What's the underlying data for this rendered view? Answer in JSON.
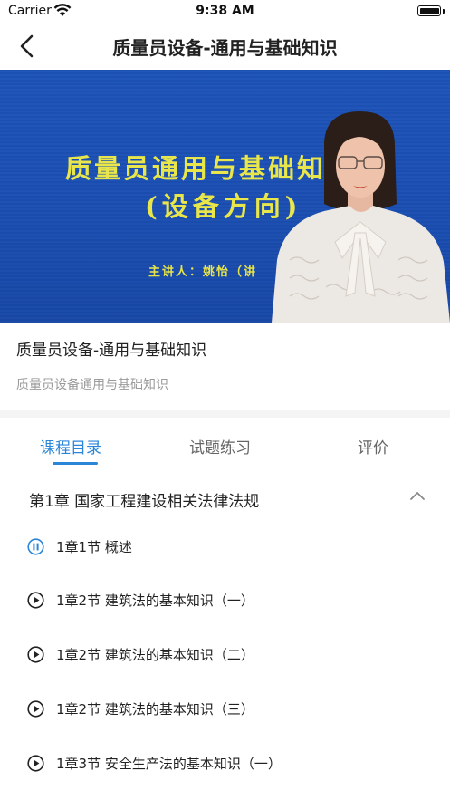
{
  "status": {
    "carrier": "Carrier",
    "time": "9:38 AM"
  },
  "nav": {
    "title": "质量员设备-通用与基础知识",
    "back_icon": "chevron-left-icon"
  },
  "video": {
    "slide_title": "质量员通用与基础知",
    "slide_subtitle": "(设备方向)",
    "slide_lecturer": "主讲人：姚怡（讲",
    "colors": {
      "background": "#1a4eb2",
      "slide_text": "#e8e64a"
    }
  },
  "course": {
    "title": "质量员设备-通用与基础知识",
    "subtitle": "质量员设备通用与基础知识"
  },
  "tabs": [
    {
      "label": "课程目录",
      "active": true
    },
    {
      "label": "试题练习",
      "active": false
    },
    {
      "label": "评价",
      "active": false
    }
  ],
  "accent_color": "#2b86d8",
  "chapter": {
    "label": "第1章 国家工程建设相关法律法规",
    "icon": "chevron-up-icon"
  },
  "lessons": [
    {
      "label": "1章1节 概述",
      "icon": "pause-circle-icon",
      "playing": true
    },
    {
      "label": "1章2节 建筑法的基本知识（一）",
      "icon": "play-circle-icon",
      "playing": false
    },
    {
      "label": "1章2节 建筑法的基本知识（二）",
      "icon": "play-circle-icon",
      "playing": false
    },
    {
      "label": "1章2节 建筑法的基本知识（三）",
      "icon": "play-circle-icon",
      "playing": false
    },
    {
      "label": "1章3节 安全生产法的基本知识（一）",
      "icon": "play-circle-icon",
      "playing": false
    }
  ]
}
